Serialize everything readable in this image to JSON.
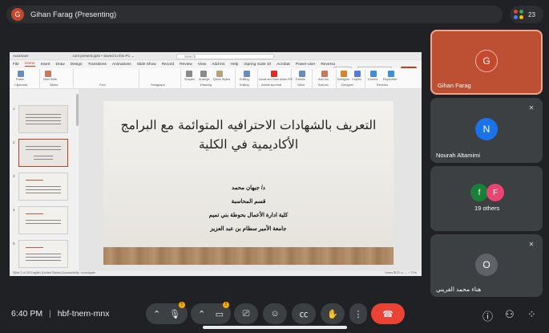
{
  "top": {
    "presenter_initial": "G",
    "presenter_label": "Gihan Farag (Presenting)",
    "participant_count": "23"
  },
  "ppt": {
    "autosave": "AutoSave",
    "file_name": "cont present.pptx • Saved to this PC ⌄",
    "search_placeholder": "Search",
    "menus": [
      "File",
      "Home",
      "Insert",
      "Draw",
      "Design",
      "Transitions",
      "Animations",
      "Slide Show",
      "Record",
      "Review",
      "View",
      "Add-ins",
      "Help",
      "iSpring Suite 10",
      "Acrobat",
      "Power-user",
      "Reverso"
    ],
    "record_btn": "Record",
    "present_btn": "Present in Teams",
    "share_btn": "Share",
    "ribbon_groups": [
      "Clipboard",
      "Slides",
      "Font",
      "Paragraph",
      "Drawing",
      "Editing",
      "Adobe Acrobat",
      "Voice",
      "Add-ins",
      "Designer",
      "Reverso"
    ],
    "ribbon_buttons": [
      "Paste",
      "New Slide",
      "Shapes",
      "Arrange",
      "Quick Styles",
      "Editing",
      "Create and Share Adobe PDF",
      "Dictate",
      "Add-ins",
      "Designer",
      "Copilot",
      "Correct",
      "Rephraser"
    ],
    "thumb_numbers": [
      "1",
      "2",
      "3",
      "4",
      "5"
    ],
    "slide": {
      "title": "التعريف بالشهادات الاحترافيه المتوائمة مع البرامج الأكاديمية في الكلية",
      "lines": [
        "د/ جيهان محمد",
        "قسم المحاسبة",
        "كلية ادارة الأعمال بحوطة بني تميم",
        "جامعة الأمير سطام بن عبد العزيز"
      ]
    },
    "status_left": "Slide 2 of 25    English (United States)    Accessibility: Investigate",
    "status_right": "Notes    ⊞  ⊟  ▭    — + 70%"
  },
  "tiles": [
    {
      "initial": "G",
      "name": "Gihan Farag",
      "color": "#c5472c"
    },
    {
      "initial": "N",
      "name": "Nourah Altamimi",
      "color": "#1a73e8"
    },
    {
      "initials": [
        "f",
        "F"
      ],
      "colors": [
        "#188038",
        "#e8446f"
      ],
      "name": "19 others"
    },
    {
      "initial": "O",
      "name": "هناء محمد القريني",
      "color": "#5f6368"
    }
  ],
  "bottom": {
    "time": "6:40 PM",
    "separator": "|",
    "meeting_code": "hbf-tnem-mnx",
    "badge": "!"
  },
  "colors": {
    "accent": "#c43e1c",
    "end_call": "#ea4335",
    "warning": "#f9ab00"
  }
}
